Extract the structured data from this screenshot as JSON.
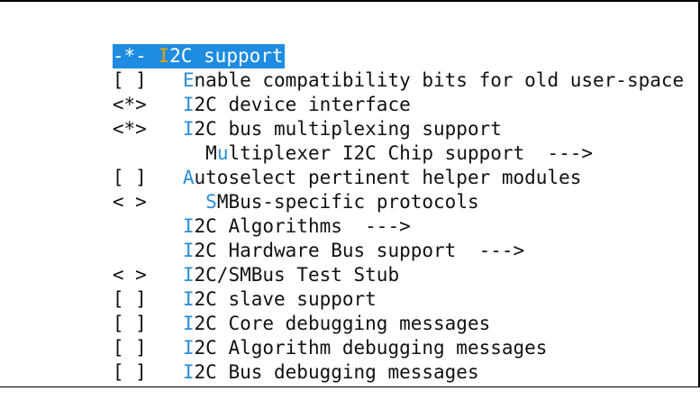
{
  "menu": {
    "items": [
      {
        "state": "-*-",
        "hotkey": "I",
        "label_rest": "2C support",
        "selected": true,
        "indent": ""
      },
      {
        "state": "[ ]",
        "hotkey": "E",
        "label_rest": "nable compatibility bits for old user-space",
        "indent": ""
      },
      {
        "state": "<*>",
        "hotkey": "I",
        "label_rest": "2C device interface",
        "indent": ""
      },
      {
        "state": "<*>",
        "hotkey": "I",
        "label_rest": "2C bus multiplexing support",
        "indent": ""
      },
      {
        "state": "",
        "indent": "  ",
        "hotkey_prefix": "M",
        "hotkey": "u",
        "label_rest": "ltiplexer I2C Chip support  --->"
      },
      {
        "state": "[ ]",
        "hotkey": "A",
        "label_rest": "utoselect pertinent helper modules",
        "indent": ""
      },
      {
        "state": "< >",
        "indent": "  ",
        "hotkey": "S",
        "label_rest": "MBus-specific protocols"
      },
      {
        "state": "",
        "hotkey": "I",
        "label_rest": "2C Algorithms  --->",
        "indent": ""
      },
      {
        "state": "",
        "hotkey": "I",
        "label_rest": "2C Hardware Bus support  --->",
        "indent": ""
      },
      {
        "state": "< >",
        "hotkey": "I",
        "label_rest": "2C/SMBus Test Stub",
        "indent": ""
      },
      {
        "state": "[ ]",
        "hotkey": "I",
        "label_rest": "2C slave support",
        "indent": ""
      },
      {
        "state": "[ ]",
        "hotkey": "I",
        "label_rest": "2C Core debugging messages",
        "indent": ""
      },
      {
        "state": "[ ]",
        "hotkey": "I",
        "label_rest": "2C Algorithm debugging messages",
        "indent": ""
      },
      {
        "state": "[ ]",
        "hotkey": "I",
        "label_rest": "2C Bus debugging messages",
        "indent": ""
      }
    ]
  },
  "colors": {
    "selection_background": "#1e8ce0",
    "hotkey": "#2a8fd6",
    "selected_hotkey": "#e9a200"
  }
}
